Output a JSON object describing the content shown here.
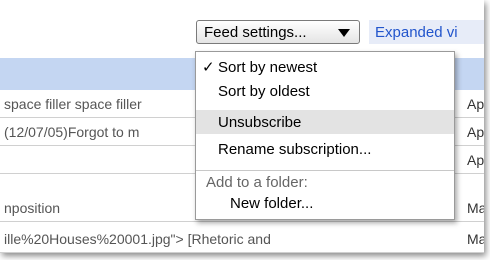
{
  "toolbar": {
    "feed_settings_label": "Feed settings...",
    "expanded_view_label": "Expanded vi"
  },
  "menu": {
    "items": [
      {
        "label": "Sort by newest",
        "checked": true,
        "check": "✓"
      },
      {
        "label": "Sort by oldest",
        "checked": false,
        "check": ""
      },
      {
        "label": "Unsubscribe",
        "checked": false,
        "check": "",
        "highlighted": true
      },
      {
        "label": "Rename subscription...",
        "checked": false,
        "check": ""
      }
    ],
    "folder_caption": "Add to a folder:",
    "new_folder_label": "New folder..."
  },
  "rows": [
    {
      "title": "space filler space filler",
      "date": "Ap"
    },
    {
      "title": "(12/07/05)Forgot to m",
      "date": "Ap"
    },
    {
      "title": "",
      "date": "Ap"
    },
    {
      "title": "nposition",
      "date": "Ma"
    },
    {
      "title": "ille%20Houses%20001.jpg\"> [Rhetoric and",
      "date": "Ma"
    }
  ],
  "colors": {
    "header_bar": "#c4d6f2",
    "link": "#2255cc",
    "menu_highlight": "#e3e3e3"
  }
}
